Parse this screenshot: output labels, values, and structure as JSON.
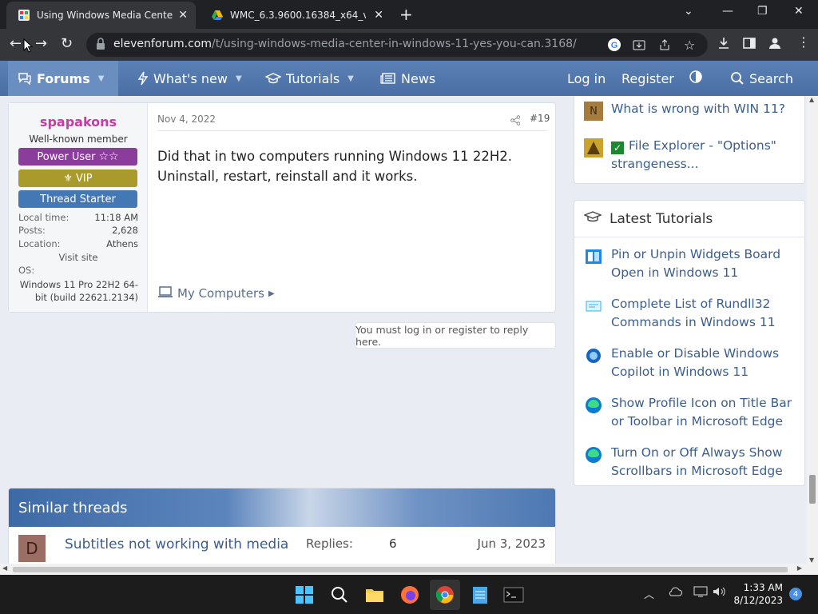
{
  "browser": {
    "tabs": [
      {
        "title": "Using Windows Media Center in",
        "active": true
      },
      {
        "title": "WMC_6.3.9600.16384_x64_v12.7z",
        "active": false
      }
    ],
    "url_host": "elevenforum.com",
    "url_path": "/t/using-windows-media-center-in-windows-11-yes-you-can.3168/"
  },
  "nav": {
    "forums": "Forums",
    "whats_new": "What's new",
    "tutorials": "Tutorials",
    "news": "News",
    "login": "Log in",
    "register": "Register",
    "search": "Search"
  },
  "post": {
    "username": "spapakons",
    "user_title": "Well-known member",
    "banners": {
      "power_user": "Power User",
      "vip": "VIP",
      "thread_starter": "Thread Starter"
    },
    "stats": [
      {
        "key": "Local time:",
        "value": "11:18 AM"
      },
      {
        "key": "Posts:",
        "value": "2,628"
      },
      {
        "key": "Location:",
        "value": "Athens"
      }
    ],
    "visit_site": "Visit site",
    "os_label": "OS:",
    "os_value": "Windows 11 Pro 22H2 64-bit (build 22621.2134)",
    "date": "Nov 4, 2022",
    "number": "#19",
    "body": "Did that in two computers running Windows 11 22H2. Uninstall, restart, reinstall and it works.",
    "my_computers": "My Computers"
  },
  "reply_note": "You must log in or register to reply here.",
  "similar": {
    "heading": "Similar threads",
    "rows": [
      {
        "avatar": "D",
        "title": "Subtitles not working with media",
        "replies_label": "Replies:",
        "replies": "6",
        "date": "Jun 3, 2023"
      }
    ]
  },
  "sidebar": {
    "threads": [
      {
        "icon": "N",
        "title": "What is wrong with WIN 11?"
      },
      {
        "title": "File Explorer - \"Options\" strangeness..."
      }
    ],
    "tutorials_heading": "Latest Tutorials",
    "tutorials": [
      {
        "title": "Pin or Unpin Widgets Board Open in Windows 11"
      },
      {
        "title": "Complete List of Rundll32 Commands in Windows 11"
      },
      {
        "title": "Enable or Disable Windows Copilot in Windows 11"
      },
      {
        "title": "Show Profile Icon on Title Bar or Toolbar in Microsoft Edge"
      },
      {
        "title": "Turn On or Off Always Show Scrollbars in Microsoft Edge"
      }
    ]
  },
  "taskbar": {
    "time": "1:33 AM",
    "date": "8/12/2023",
    "notifications": "4"
  },
  "colors": {
    "nav_bg": "#4a6fa5",
    "username": "#c83aa6",
    "link": "#3b5e8c"
  }
}
